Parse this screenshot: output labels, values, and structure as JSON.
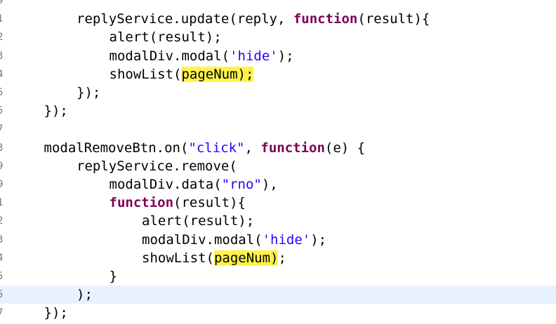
{
  "editor": {
    "lines": [
      {
        "num": "9",
        "indent": 0,
        "tokens": []
      },
      {
        "num": "1",
        "indent": 2,
        "tokens": [
          {
            "t": "replyService.update(reply, "
          },
          {
            "t": "function",
            "c": "kw"
          },
          {
            "t": "(result){"
          }
        ]
      },
      {
        "num": "2",
        "indent": 3,
        "tokens": [
          {
            "t": "alert(result);"
          }
        ]
      },
      {
        "num": "3",
        "indent": 3,
        "tokens": [
          {
            "t": "modalDiv.modal("
          },
          {
            "t": "'hide'",
            "c": "str"
          },
          {
            "t": ");"
          }
        ]
      },
      {
        "num": "4",
        "indent": 3,
        "tokens": [
          {
            "t": "showList("
          },
          {
            "t": "pageNum);",
            "c": "hl"
          }
        ]
      },
      {
        "num": "5",
        "indent": 2,
        "tokens": [
          {
            "t": "});"
          }
        ]
      },
      {
        "num": "5",
        "indent": 1,
        "tokens": [
          {
            "t": "});"
          }
        ]
      },
      {
        "num": "7",
        "indent": 0,
        "tokens": []
      },
      {
        "num": "3",
        "indent": 1,
        "tokens": [
          {
            "t": "modalRemoveBtn.on("
          },
          {
            "t": "\"click\"",
            "c": "str"
          },
          {
            "t": ", "
          },
          {
            "t": "function",
            "c": "kw"
          },
          {
            "t": "(e) {"
          }
        ]
      },
      {
        "num": "9",
        "indent": 2,
        "tokens": [
          {
            "t": "replyService.remove("
          }
        ]
      },
      {
        "num": "9",
        "indent": 3,
        "tokens": [
          {
            "t": "modalDiv.data("
          },
          {
            "t": "\"rno\"",
            "c": "str"
          },
          {
            "t": "),"
          }
        ]
      },
      {
        "num": "1",
        "indent": 3,
        "tokens": [
          {
            "t": "function",
            "c": "kw"
          },
          {
            "t": "(result){"
          }
        ]
      },
      {
        "num": "2",
        "indent": 4,
        "tokens": [
          {
            "t": "alert(result);"
          }
        ]
      },
      {
        "num": "3",
        "indent": 4,
        "tokens": [
          {
            "t": "modalDiv.modal("
          },
          {
            "t": "'hide'",
            "c": "str"
          },
          {
            "t": ");"
          }
        ]
      },
      {
        "num": "4",
        "indent": 4,
        "tokens": [
          {
            "t": "showList("
          },
          {
            "t": "pageNum)",
            "c": "hl"
          },
          {
            "t": ";"
          }
        ]
      },
      {
        "num": "5",
        "indent": 3,
        "tokens": [
          {
            "t": "}"
          }
        ]
      },
      {
        "num": "5",
        "indent": 2,
        "tokens": [
          {
            "t": ");"
          }
        ],
        "current": true
      },
      {
        "num": "7",
        "indent": 1,
        "tokens": [
          {
            "t": "});"
          }
        ]
      }
    ]
  }
}
